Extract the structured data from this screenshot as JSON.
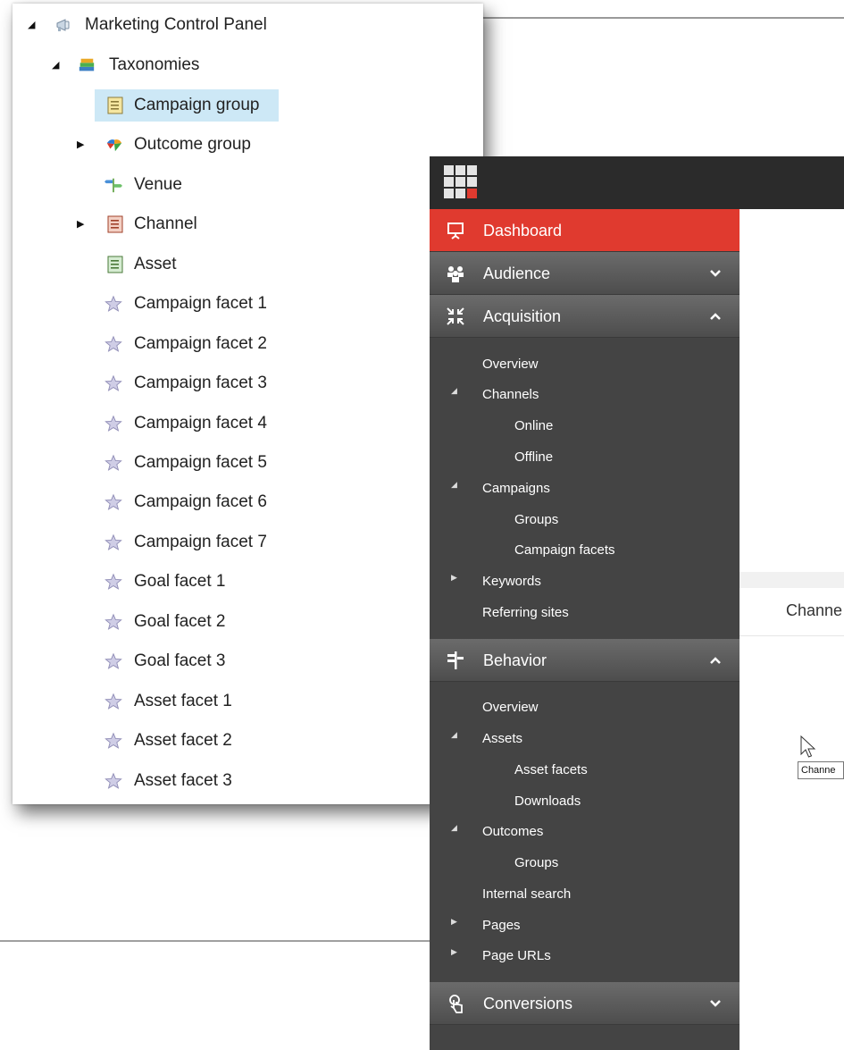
{
  "tree": {
    "root": {
      "label": "Marketing Control Panel",
      "icon": "megaphone-icon"
    },
    "taxonomies": {
      "label": "Taxonomies",
      "icon": "books-icon"
    },
    "items": [
      {
        "label": "Campaign group",
        "icon": "list-icon-yellow",
        "selected": true,
        "expander": false
      },
      {
        "label": "Outcome group",
        "icon": "puzzle-icon",
        "selected": false,
        "expander": true
      },
      {
        "label": "Venue",
        "icon": "signpost-icon",
        "selected": false,
        "expander": false
      },
      {
        "label": "Channel",
        "icon": "list-icon-red",
        "selected": false,
        "expander": true
      },
      {
        "label": "Asset",
        "icon": "list-icon-green",
        "selected": false,
        "expander": false
      },
      {
        "label": "Campaign facet 1",
        "icon": "star-icon"
      },
      {
        "label": "Campaign facet 2",
        "icon": "star-icon"
      },
      {
        "label": "Campaign facet 3",
        "icon": "star-icon"
      },
      {
        "label": "Campaign facet 4",
        "icon": "star-icon"
      },
      {
        "label": "Campaign facet 5",
        "icon": "star-icon"
      },
      {
        "label": "Campaign facet 6",
        "icon": "star-icon"
      },
      {
        "label": "Campaign facet 7",
        "icon": "star-icon"
      },
      {
        "label": "Goal facet 1",
        "icon": "star-icon"
      },
      {
        "label": "Goal facet 2",
        "icon": "star-icon"
      },
      {
        "label": "Goal facet 3",
        "icon": "star-icon"
      },
      {
        "label": "Asset facet 1",
        "icon": "star-icon"
      },
      {
        "label": "Asset facet 2",
        "icon": "star-icon"
      },
      {
        "label": "Asset facet 3",
        "icon": "star-icon"
      }
    ]
  },
  "sidebar": {
    "dashboard": "Dashboard",
    "audience": "Audience",
    "acquisition": {
      "label": "Acquisition",
      "items": [
        "Overview",
        "Channels",
        "Online",
        "Offline",
        "Campaigns",
        "Groups",
        "Campaign facets",
        "Keywords",
        "Referring sites"
      ]
    },
    "behavior": {
      "label": "Behavior",
      "items": [
        "Overview",
        "Assets",
        "Asset facets",
        "Downloads",
        "Outcomes",
        "Groups",
        "Internal search",
        "Pages",
        "Page URLs"
      ]
    },
    "conversions": "Conversions"
  },
  "content": {
    "channels_header": "Channe",
    "tooltip": "Channe"
  },
  "colors": {
    "accent": "#e03a2f",
    "sidebar_bg": "#444444",
    "topbar_bg": "#2b2b2b",
    "selection": "#cde8f6"
  }
}
